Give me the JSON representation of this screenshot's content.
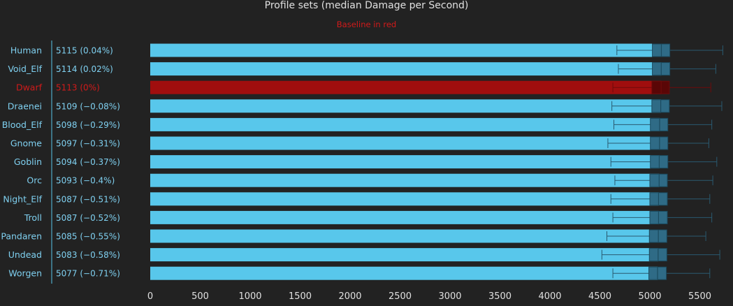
{
  "chart_data": {
    "type": "bar",
    "title": "Profile sets (median Damage per Second)",
    "subtitle": "Baseline in red",
    "categories": [
      "Human",
      "Void_Elf",
      "Dwarf",
      "Draenei",
      "Blood_Elf",
      "Gnome",
      "Goblin",
      "Orc",
      "Night_Elf",
      "Troll",
      "Pandaren",
      "Undead",
      "Worgen"
    ],
    "values": [
      5115,
      5114,
      5113,
      5109,
      5098,
      5097,
      5094,
      5093,
      5087,
      5087,
      5085,
      5083,
      5077
    ],
    "value_labels": [
      "5115 (0.04%)",
      "5114 (0.02%)",
      "5113 (0%)",
      "5109 (−0.08%)",
      "5098 (−0.29%)",
      "5097 (−0.31%)",
      "5094 (−0.37%)",
      "5093 (−0.4%)",
      "5087 (−0.51%)",
      "5087 (−0.52%)",
      "5085 (−0.55%)",
      "5083 (−0.58%)",
      "5077 (−0.71%)"
    ],
    "baseline_index": 2,
    "box": [
      {
        "whisker_low": 4670,
        "q1": 5025,
        "q3": 5200,
        "whisker_high": 5730
      },
      {
        "whisker_low": 4685,
        "q1": 5025,
        "q3": 5200,
        "whisker_high": 5660
      },
      {
        "whisker_low": 4630,
        "q1": 5020,
        "q3": 5195,
        "whisker_high": 5610
      },
      {
        "whisker_low": 4620,
        "q1": 5020,
        "q3": 5195,
        "whisker_high": 5720
      },
      {
        "whisker_low": 4640,
        "q1": 5005,
        "q3": 5180,
        "whisker_high": 5620
      },
      {
        "whisker_low": 4580,
        "q1": 5005,
        "q3": 5180,
        "whisker_high": 5590
      },
      {
        "whisker_low": 4610,
        "q1": 5005,
        "q3": 5180,
        "whisker_high": 5670
      },
      {
        "whisker_low": 4650,
        "q1": 5000,
        "q3": 5175,
        "whisker_high": 5630
      },
      {
        "whisker_low": 4610,
        "q1": 5000,
        "q3": 5175,
        "whisker_high": 5600
      },
      {
        "whisker_low": 4630,
        "q1": 5000,
        "q3": 5175,
        "whisker_high": 5620
      },
      {
        "whisker_low": 4570,
        "q1": 4995,
        "q3": 5170,
        "whisker_high": 5560
      },
      {
        "whisker_low": 4520,
        "q1": 4995,
        "q3": 5170,
        "whisker_high": 5700
      },
      {
        "whisker_low": 4630,
        "q1": 4990,
        "q3": 5165,
        "whisker_high": 5600
      }
    ],
    "xlim": [
      0,
      5800
    ],
    "xticks": [
      0,
      500,
      1000,
      1500,
      2000,
      2500,
      3000,
      3500,
      4000,
      4500,
      5000,
      5500
    ],
    "xlabel": "",
    "ylabel": "",
    "grid": false,
    "colors": {
      "background": "#222222",
      "bar": "#58c7eb",
      "baseline_bar": "#a00e0e",
      "baseline_text": "#d11a1a",
      "text": "#7fd0f0",
      "title": "#e0e0e0",
      "tick": "#e0e0e0",
      "axis": "#58c7eb",
      "box_fill": "#2f6b86",
      "box_stroke": "#1b4a5e",
      "whisker": "#2a5a70",
      "baseline_box_fill": "#5a0606",
      "baseline_whisker": "#6e0b0b"
    }
  }
}
